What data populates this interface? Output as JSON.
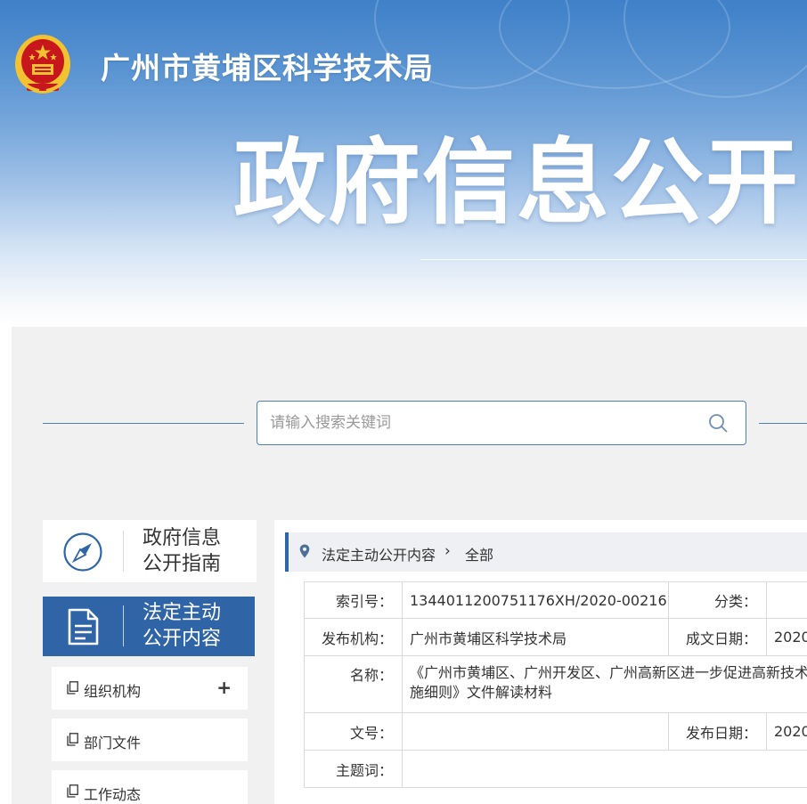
{
  "header": {
    "site_title": "广州市黄埔区科学技术局",
    "hero_title": "政府信息公开"
  },
  "search": {
    "placeholder": "请输入搜索关键词"
  },
  "sidebar": {
    "guide_label_line1": "政府信息",
    "guide_label_line2": "公开指南",
    "active_label_line1": "法定主动",
    "active_label_line2": "公开内容",
    "items": [
      {
        "label": "组织机构",
        "expand": "+"
      },
      {
        "label": "部门文件"
      },
      {
        "label": "工作动态"
      }
    ]
  },
  "breadcrumb": {
    "item1": "法定主动公开内容",
    "separator": "›",
    "item2": "全部"
  },
  "meta": {
    "index_label": "索引号：",
    "index_value": "1344011200751176XH/2020-00216",
    "category_label": "分类：",
    "category_value": "",
    "publisher_label": "发布机构：",
    "publisher_value": "广州市黄埔区科学技术局",
    "created_label": "成文日期：",
    "created_value": "2020",
    "name_label": "名称：",
    "name_value": "《广州市黄埔区、广州开发区、广州高新区进一步促进高新技术施细则》文件解读材料",
    "docno_label": "文号：",
    "docno_value": "",
    "pubdate_label": "发布日期：",
    "pubdate_value": "2020",
    "subject_label": "主题词：",
    "subject_value": ""
  },
  "colors": {
    "accent": "#2f65a6",
    "border_blue": "#4d7fb8",
    "panel_gray": "#f1f1f1",
    "emblem_red": "#c8161d",
    "emblem_gold": "#f2c230"
  }
}
